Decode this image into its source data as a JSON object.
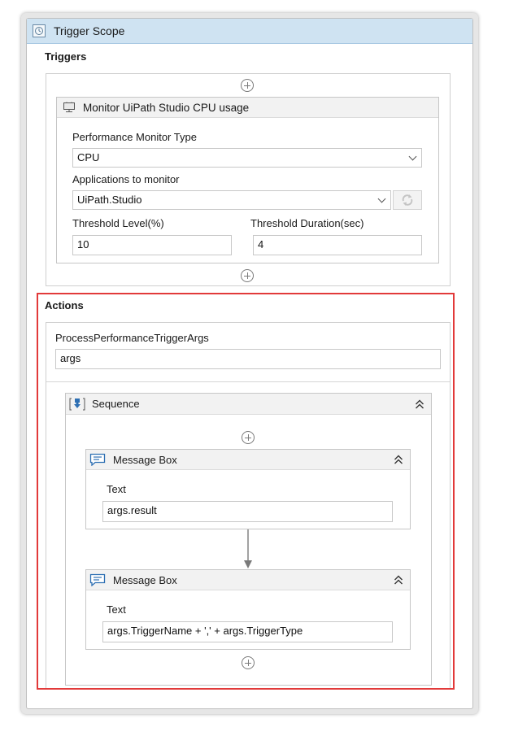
{
  "trigger_scope": {
    "title": "Trigger Scope",
    "icon": "clock-icon"
  },
  "triggers": {
    "label": "Triggers",
    "activity": {
      "title": "Monitor UiPath Studio CPU usage",
      "icon": "monitor-icon",
      "performance_monitor_type_label": "Performance Monitor Type",
      "performance_monitor_type_value": "CPU",
      "applications_label": "Applications to monitor",
      "applications_value": "UiPath.Studio",
      "threshold_level_label": "Threshold Level(%)",
      "threshold_level_value": "10",
      "threshold_duration_label": "Threshold Duration(sec)",
      "threshold_duration_value": "4"
    }
  },
  "actions": {
    "label": "Actions",
    "args_type_label": "ProcessPerformanceTriggerArgs",
    "args_value": "args",
    "sequence": {
      "title": "Sequence",
      "icon": "sequence-icon",
      "message_boxes": [
        {
          "title": "Message Box",
          "text_label": "Text",
          "text_value": "args.result"
        },
        {
          "title": "Message Box",
          "text_label": "Text",
          "text_value": "args.TriggerName + ',' + args.TriggerType"
        }
      ]
    }
  },
  "colors": {
    "header_blue": "#cfe3f2",
    "highlight_red": "#e23a3a",
    "message_icon_blue": "#2d6fb3"
  }
}
